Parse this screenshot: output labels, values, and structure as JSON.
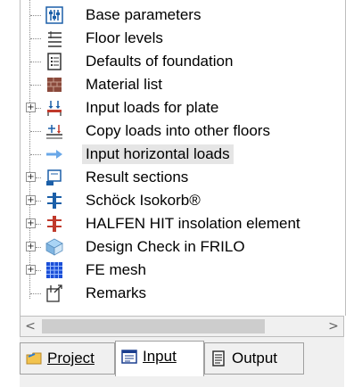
{
  "tree": {
    "items": [
      {
        "label": "Base parameters",
        "icon": "base-parameters-icon",
        "expandable": false,
        "selected": false
      },
      {
        "label": "Floor levels",
        "icon": "floor-levels-icon",
        "expandable": false,
        "selected": false
      },
      {
        "label": "Defaults of foundation",
        "icon": "defaults-foundation-icon",
        "expandable": false,
        "selected": false
      },
      {
        "label": "Material list",
        "icon": "material-list-icon",
        "expandable": false,
        "selected": false
      },
      {
        "label": "Input loads for plate",
        "icon": "input-loads-icon",
        "expandable": true,
        "selected": false
      },
      {
        "label": "Copy loads into other floors",
        "icon": "copy-loads-icon",
        "expandable": false,
        "selected": false
      },
      {
        "label": "Input horizontal loads",
        "icon": "arrow-right-icon",
        "expandable": false,
        "selected": true
      },
      {
        "label": "Result sections",
        "icon": "result-sections-icon",
        "expandable": true,
        "selected": false
      },
      {
        "label": "Schöck Isokorb®",
        "icon": "schoeck-isokorb-icon",
        "expandable": true,
        "selected": false
      },
      {
        "label": "HALFEN HIT insolation element",
        "icon": "halfen-hit-icon",
        "expandable": true,
        "selected": false
      },
      {
        "label": "Design Check in FRILO",
        "icon": "design-check-icon",
        "expandable": true,
        "selected": false
      },
      {
        "label": "FE mesh",
        "icon": "fe-mesh-icon",
        "expandable": true,
        "selected": false
      },
      {
        "label": "Remarks",
        "icon": "remarks-icon",
        "expandable": false,
        "selected": false
      }
    ]
  },
  "scrollbar": {
    "left_arrow": "<",
    "right_arrow": ">"
  },
  "tabs": [
    {
      "label": "Project",
      "icon": "project-icon",
      "active": false
    },
    {
      "label": "Input",
      "icon": "input-icon",
      "active": true
    },
    {
      "label": "Output",
      "icon": "output-icon",
      "active": false
    }
  ]
}
